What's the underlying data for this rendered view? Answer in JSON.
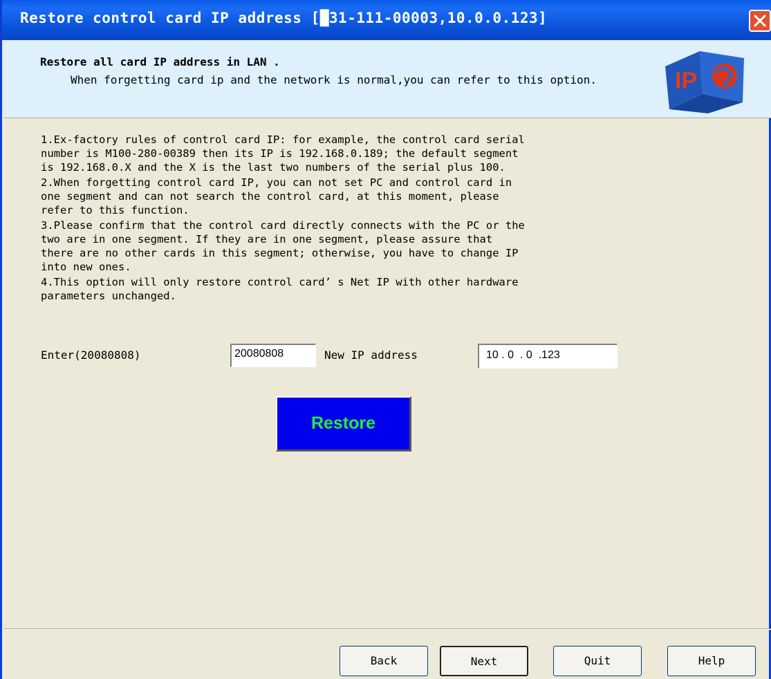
{
  "window": {
    "title": "Restore control card IP address [█31-111-00003,10.0.0.123]"
  },
  "header": {
    "title": "Restore all card IP address in LAN .",
    "subtitle": "When forgetting card ip and the network is normal,you can refer to this option."
  },
  "instructions": [
    "1.Ex-factory rules of control card IP: for example, the control card serial\nnumber is M100-280-00389 then its IP is 192.168.0.189; the default segment\nis 192.168.0.X and the X is the last two numbers of the serial plus 100.",
    "2.When forgetting control card IP, you can not set PC and control card in\none segment and can not search the control card, at this moment, please\nrefer to this function.",
    "3.Please confirm that the control card directly connects with the PC or the\ntwo are in one segment. If they are in one segment, please assure that\nthere are no other cards in this segment; otherwise, you have to change IP\ninto new ones.",
    "4.This option will only restore control card’ s Net IP with other hardware\nparameters unchanged."
  ],
  "form": {
    "enter_label": "Enter(20080808)",
    "enter_value": "20080808",
    "ip_label": "New IP address",
    "ip_value": "10 . 0  . 0  .123"
  },
  "restore_button": "Restore",
  "nav": {
    "back": "Back",
    "next": "Next",
    "quit": "Quit",
    "help": "Help"
  },
  "colors": {
    "title_bar": "#0a52d8",
    "header_bg": "#ddf0fb",
    "restore_bg": "#0000ee",
    "restore_text": "#22ee33"
  }
}
